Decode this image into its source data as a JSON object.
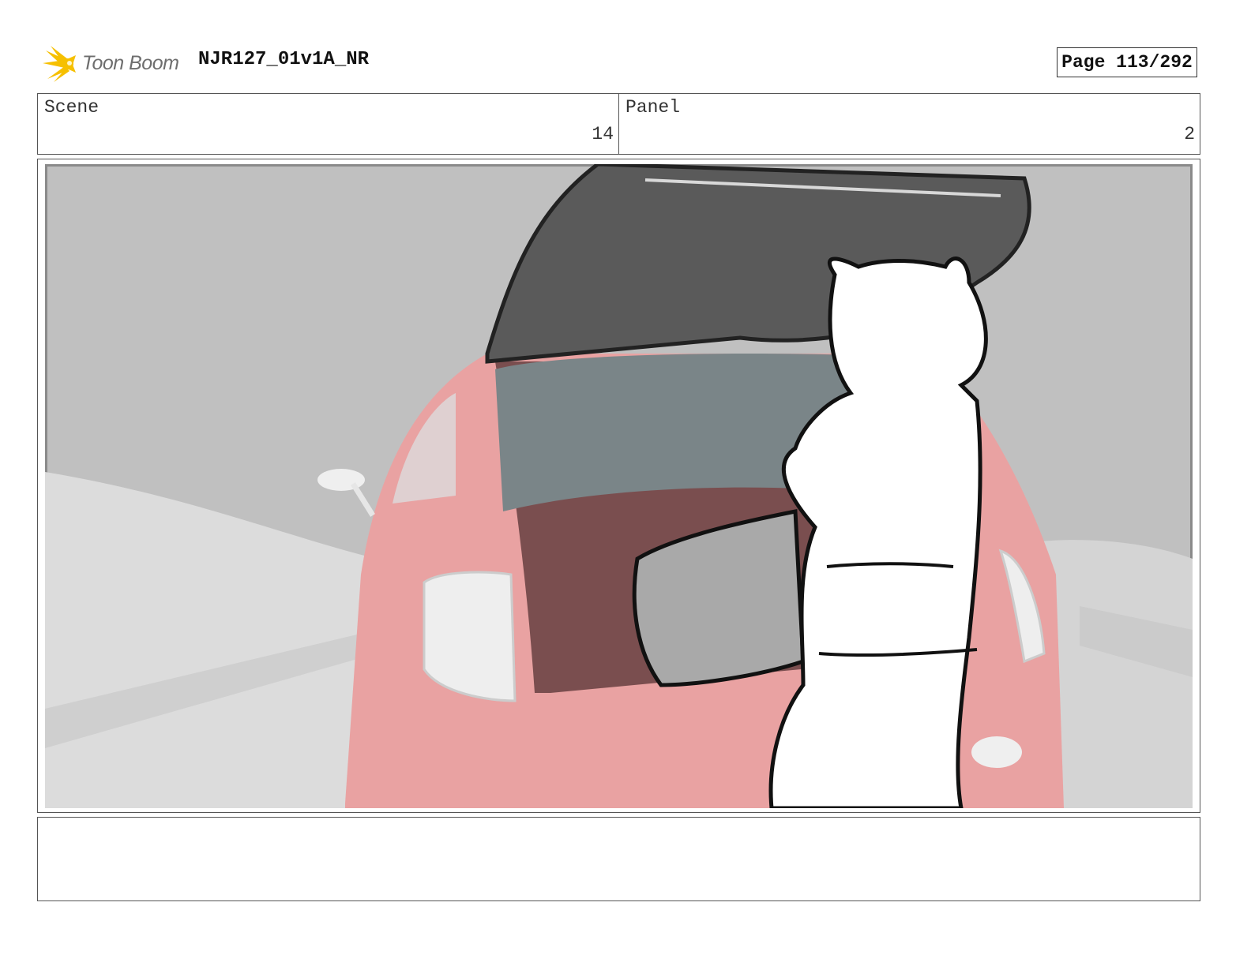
{
  "header": {
    "logo_text": "Toon Boom",
    "project_title": "NJR127_01v1A_NR",
    "page_label": "Page 113/292"
  },
  "info": {
    "scene_label": "Scene",
    "scene_value": "14",
    "panel_label": "Panel",
    "panel_value": "2"
  },
  "caption": {
    "text": ""
  },
  "colors": {
    "logo_yellow": "#f6c000",
    "car_red": "#e9a2a2",
    "trunk_lid": "#5a5a5a",
    "sky": "#c0c0c0"
  }
}
